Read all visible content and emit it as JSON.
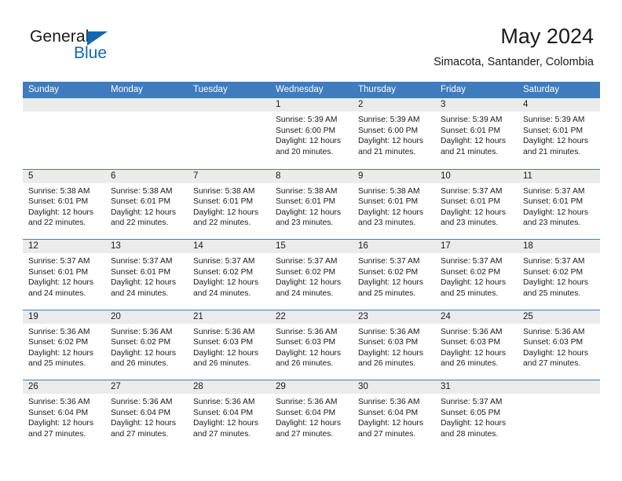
{
  "brand": {
    "word_one": "General",
    "word_two": "Blue",
    "accent_color": "#1268b3"
  },
  "header": {
    "title": "May 2024",
    "subtitle": "Simacota, Santander, Colombia"
  },
  "calendar": {
    "header_bg": "#3f7cbf",
    "daynum_bg": "#ebebeb",
    "weekdays": [
      "Sunday",
      "Monday",
      "Tuesday",
      "Wednesday",
      "Thursday",
      "Friday",
      "Saturday"
    ],
    "weeks": [
      [
        {
          "day": "",
          "empty": true
        },
        {
          "day": "",
          "empty": true
        },
        {
          "day": "",
          "empty": true
        },
        {
          "day": "1",
          "sunrise": "Sunrise: 5:39 AM",
          "sunset": "Sunset: 6:00 PM",
          "daylight_1": "Daylight: 12 hours",
          "daylight_2": "and 20 minutes."
        },
        {
          "day": "2",
          "sunrise": "Sunrise: 5:39 AM",
          "sunset": "Sunset: 6:00 PM",
          "daylight_1": "Daylight: 12 hours",
          "daylight_2": "and 21 minutes."
        },
        {
          "day": "3",
          "sunrise": "Sunrise: 5:39 AM",
          "sunset": "Sunset: 6:01 PM",
          "daylight_1": "Daylight: 12 hours",
          "daylight_2": "and 21 minutes."
        },
        {
          "day": "4",
          "sunrise": "Sunrise: 5:39 AM",
          "sunset": "Sunset: 6:01 PM",
          "daylight_1": "Daylight: 12 hours",
          "daylight_2": "and 21 minutes."
        }
      ],
      [
        {
          "day": "5",
          "sunrise": "Sunrise: 5:38 AM",
          "sunset": "Sunset: 6:01 PM",
          "daylight_1": "Daylight: 12 hours",
          "daylight_2": "and 22 minutes."
        },
        {
          "day": "6",
          "sunrise": "Sunrise: 5:38 AM",
          "sunset": "Sunset: 6:01 PM",
          "daylight_1": "Daylight: 12 hours",
          "daylight_2": "and 22 minutes."
        },
        {
          "day": "7",
          "sunrise": "Sunrise: 5:38 AM",
          "sunset": "Sunset: 6:01 PM",
          "daylight_1": "Daylight: 12 hours",
          "daylight_2": "and 22 minutes."
        },
        {
          "day": "8",
          "sunrise": "Sunrise: 5:38 AM",
          "sunset": "Sunset: 6:01 PM",
          "daylight_1": "Daylight: 12 hours",
          "daylight_2": "and 23 minutes."
        },
        {
          "day": "9",
          "sunrise": "Sunrise: 5:38 AM",
          "sunset": "Sunset: 6:01 PM",
          "daylight_1": "Daylight: 12 hours",
          "daylight_2": "and 23 minutes."
        },
        {
          "day": "10",
          "sunrise": "Sunrise: 5:37 AM",
          "sunset": "Sunset: 6:01 PM",
          "daylight_1": "Daylight: 12 hours",
          "daylight_2": "and 23 minutes."
        },
        {
          "day": "11",
          "sunrise": "Sunrise: 5:37 AM",
          "sunset": "Sunset: 6:01 PM",
          "daylight_1": "Daylight: 12 hours",
          "daylight_2": "and 23 minutes."
        }
      ],
      [
        {
          "day": "12",
          "sunrise": "Sunrise: 5:37 AM",
          "sunset": "Sunset: 6:01 PM",
          "daylight_1": "Daylight: 12 hours",
          "daylight_2": "and 24 minutes."
        },
        {
          "day": "13",
          "sunrise": "Sunrise: 5:37 AM",
          "sunset": "Sunset: 6:01 PM",
          "daylight_1": "Daylight: 12 hours",
          "daylight_2": "and 24 minutes."
        },
        {
          "day": "14",
          "sunrise": "Sunrise: 5:37 AM",
          "sunset": "Sunset: 6:02 PM",
          "daylight_1": "Daylight: 12 hours",
          "daylight_2": "and 24 minutes."
        },
        {
          "day": "15",
          "sunrise": "Sunrise: 5:37 AM",
          "sunset": "Sunset: 6:02 PM",
          "daylight_1": "Daylight: 12 hours",
          "daylight_2": "and 24 minutes."
        },
        {
          "day": "16",
          "sunrise": "Sunrise: 5:37 AM",
          "sunset": "Sunset: 6:02 PM",
          "daylight_1": "Daylight: 12 hours",
          "daylight_2": "and 25 minutes."
        },
        {
          "day": "17",
          "sunrise": "Sunrise: 5:37 AM",
          "sunset": "Sunset: 6:02 PM",
          "daylight_1": "Daylight: 12 hours",
          "daylight_2": "and 25 minutes."
        },
        {
          "day": "18",
          "sunrise": "Sunrise: 5:37 AM",
          "sunset": "Sunset: 6:02 PM",
          "daylight_1": "Daylight: 12 hours",
          "daylight_2": "and 25 minutes."
        }
      ],
      [
        {
          "day": "19",
          "sunrise": "Sunrise: 5:36 AM",
          "sunset": "Sunset: 6:02 PM",
          "daylight_1": "Daylight: 12 hours",
          "daylight_2": "and 25 minutes."
        },
        {
          "day": "20",
          "sunrise": "Sunrise: 5:36 AM",
          "sunset": "Sunset: 6:02 PM",
          "daylight_1": "Daylight: 12 hours",
          "daylight_2": "and 26 minutes."
        },
        {
          "day": "21",
          "sunrise": "Sunrise: 5:36 AM",
          "sunset": "Sunset: 6:03 PM",
          "daylight_1": "Daylight: 12 hours",
          "daylight_2": "and 26 minutes."
        },
        {
          "day": "22",
          "sunrise": "Sunrise: 5:36 AM",
          "sunset": "Sunset: 6:03 PM",
          "daylight_1": "Daylight: 12 hours",
          "daylight_2": "and 26 minutes."
        },
        {
          "day": "23",
          "sunrise": "Sunrise: 5:36 AM",
          "sunset": "Sunset: 6:03 PM",
          "daylight_1": "Daylight: 12 hours",
          "daylight_2": "and 26 minutes."
        },
        {
          "day": "24",
          "sunrise": "Sunrise: 5:36 AM",
          "sunset": "Sunset: 6:03 PM",
          "daylight_1": "Daylight: 12 hours",
          "daylight_2": "and 26 minutes."
        },
        {
          "day": "25",
          "sunrise": "Sunrise: 5:36 AM",
          "sunset": "Sunset: 6:03 PM",
          "daylight_1": "Daylight: 12 hours",
          "daylight_2": "and 27 minutes."
        }
      ],
      [
        {
          "day": "26",
          "sunrise": "Sunrise: 5:36 AM",
          "sunset": "Sunset: 6:04 PM",
          "daylight_1": "Daylight: 12 hours",
          "daylight_2": "and 27 minutes."
        },
        {
          "day": "27",
          "sunrise": "Sunrise: 5:36 AM",
          "sunset": "Sunset: 6:04 PM",
          "daylight_1": "Daylight: 12 hours",
          "daylight_2": "and 27 minutes."
        },
        {
          "day": "28",
          "sunrise": "Sunrise: 5:36 AM",
          "sunset": "Sunset: 6:04 PM",
          "daylight_1": "Daylight: 12 hours",
          "daylight_2": "and 27 minutes."
        },
        {
          "day": "29",
          "sunrise": "Sunrise: 5:36 AM",
          "sunset": "Sunset: 6:04 PM",
          "daylight_1": "Daylight: 12 hours",
          "daylight_2": "and 27 minutes."
        },
        {
          "day": "30",
          "sunrise": "Sunrise: 5:36 AM",
          "sunset": "Sunset: 6:04 PM",
          "daylight_1": "Daylight: 12 hours",
          "daylight_2": "and 27 minutes."
        },
        {
          "day": "31",
          "sunrise": "Sunrise: 5:37 AM",
          "sunset": "Sunset: 6:05 PM",
          "daylight_1": "Daylight: 12 hours",
          "daylight_2": "and 28 minutes."
        },
        {
          "day": "",
          "empty": true
        }
      ]
    ]
  }
}
